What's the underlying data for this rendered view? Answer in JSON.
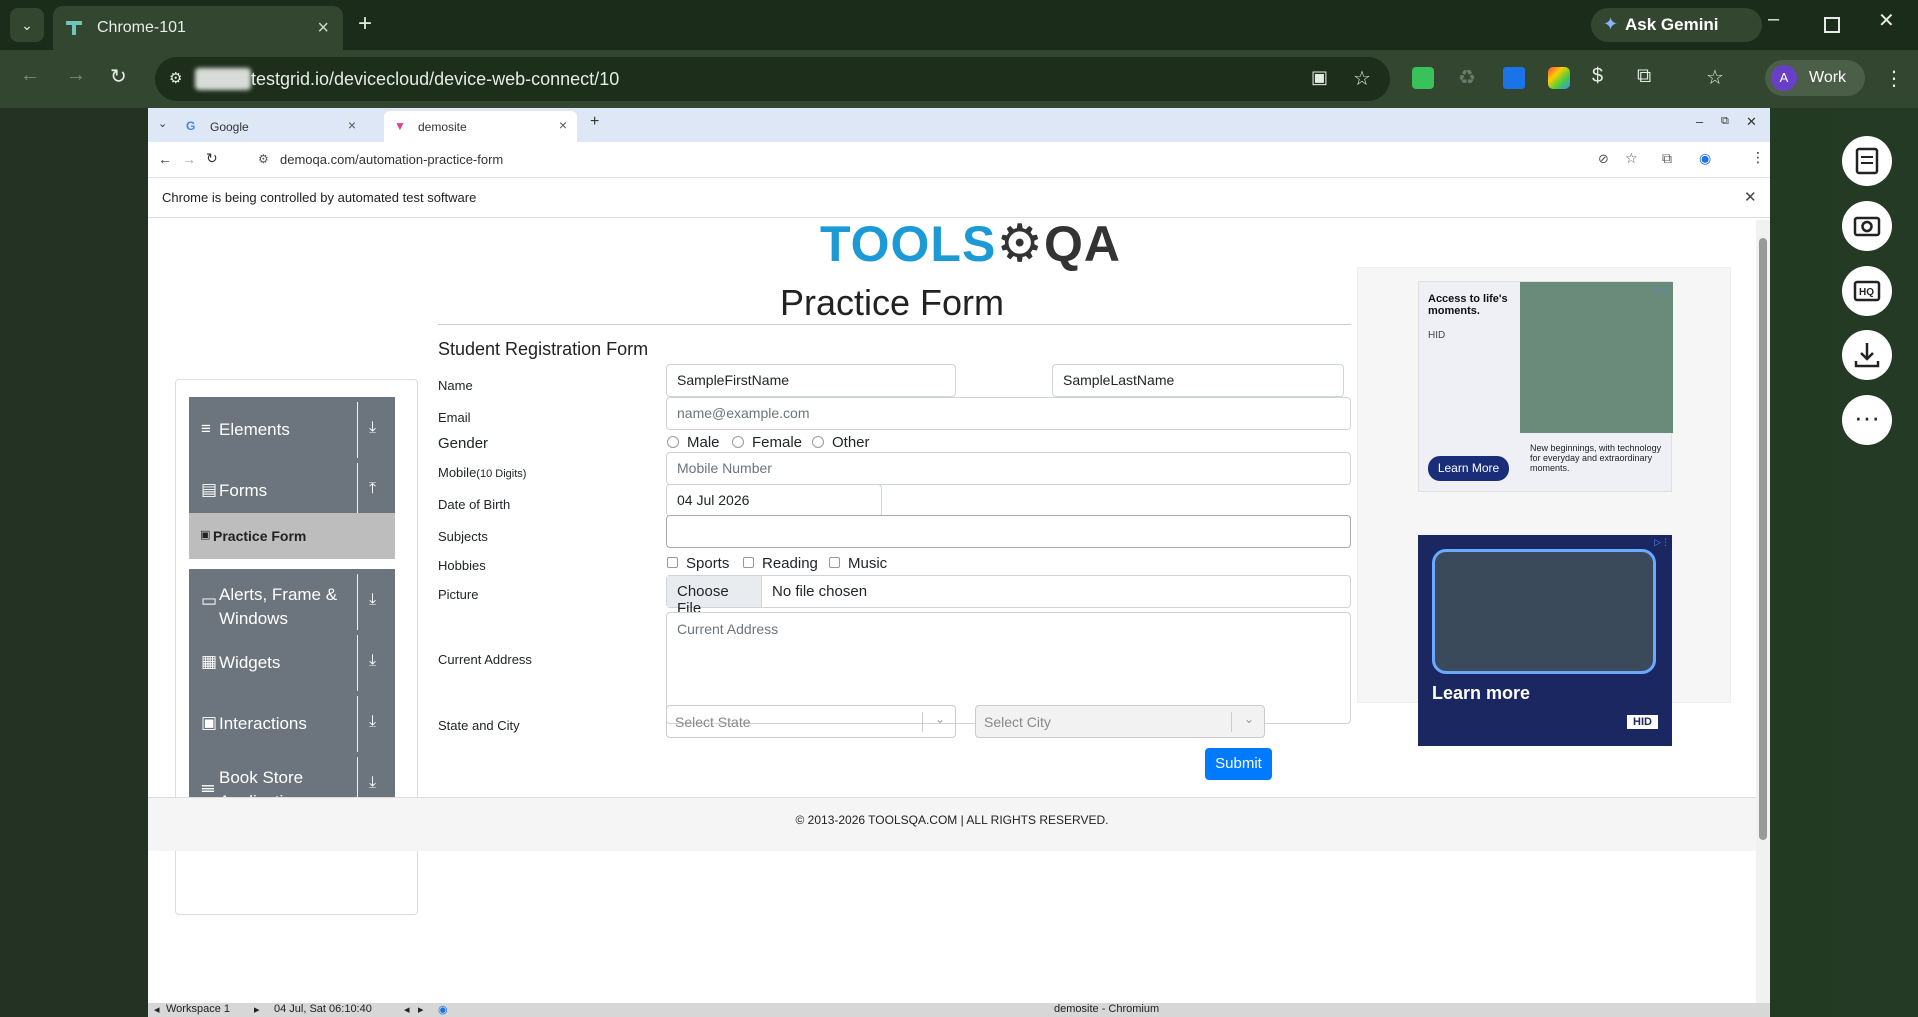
{
  "outer_browser": {
    "tab_title": "Chrome-101",
    "url": "testgrid.io/devicecloud/device-web-connect/10",
    "gemini_label": "Ask Gemini",
    "profile_initial": "A",
    "profile_label": "Work"
  },
  "inner_browser": {
    "tabs": [
      {
        "title": "Google"
      },
      {
        "title": "demosite"
      }
    ],
    "url": "demoqa.com/automation-practice-form",
    "infobar_text": "Chrome is being controlled by automated test software",
    "window_title": "demosite - Chromium"
  },
  "page": {
    "logo_tools": "TOOLS",
    "logo_qa": "QA",
    "title": "Practice Form",
    "form_title": "Student Registration Form",
    "sidebar": {
      "groups": [
        {
          "label": "Elements"
        },
        {
          "label": "Forms"
        },
        {
          "label": "Alerts, Frame & Windows"
        },
        {
          "label": "Widgets"
        },
        {
          "label": "Interactions"
        },
        {
          "label": "Book Store Application"
        }
      ],
      "active_item": "Practice Form"
    },
    "labels": {
      "name": "Name",
      "email": "Email",
      "gender": "Gender",
      "mobile": "Mobile",
      "mobile_hint": "(10 Digits)",
      "dob": "Date of Birth",
      "subjects": "Subjects",
      "hobbies": "Hobbies",
      "picture": "Picture",
      "address": "Current Address",
      "state_city": "State and City"
    },
    "fields": {
      "first_name": "SampleFirstName",
      "last_name": "SampleLastName",
      "email_placeholder": "name@example.com",
      "mobile_placeholder": "Mobile Number",
      "dob": "04 Jul 2026",
      "subjects": "",
      "choose_file": "Choose File",
      "no_file": "No file chosen",
      "address_placeholder": "Current Address",
      "state_placeholder": "Select State",
      "city_placeholder": "Select City"
    },
    "gender_options": [
      "Male",
      "Female",
      "Other"
    ],
    "hobbies_options": [
      "Sports",
      "Reading",
      "Music"
    ],
    "submit": "Submit",
    "footer": "© 2013-2026 TOOLSQA.COM | ALL RIGHTS RESERVED.",
    "ads": {
      "ad1_headline": "Access to life's moments.",
      "ad1_brand": "HID",
      "ad1_cta": "Learn More",
      "ad1_body": "New beginnings, with technology for everyday and extraordinary moments.",
      "ad2_cta": "Learn more",
      "ad2_brand": "HID"
    }
  },
  "taskbar": {
    "workspace": "Workspace 1",
    "datetime": "04 Jul, Sat 06:10:40"
  },
  "colors": {
    "outer_frame": "#1b2c1b",
    "sidebar_group": "#6c757d",
    "submit": "#007bff",
    "logo_blue": "#1b9ad6",
    "logo_dark": "#333333"
  }
}
